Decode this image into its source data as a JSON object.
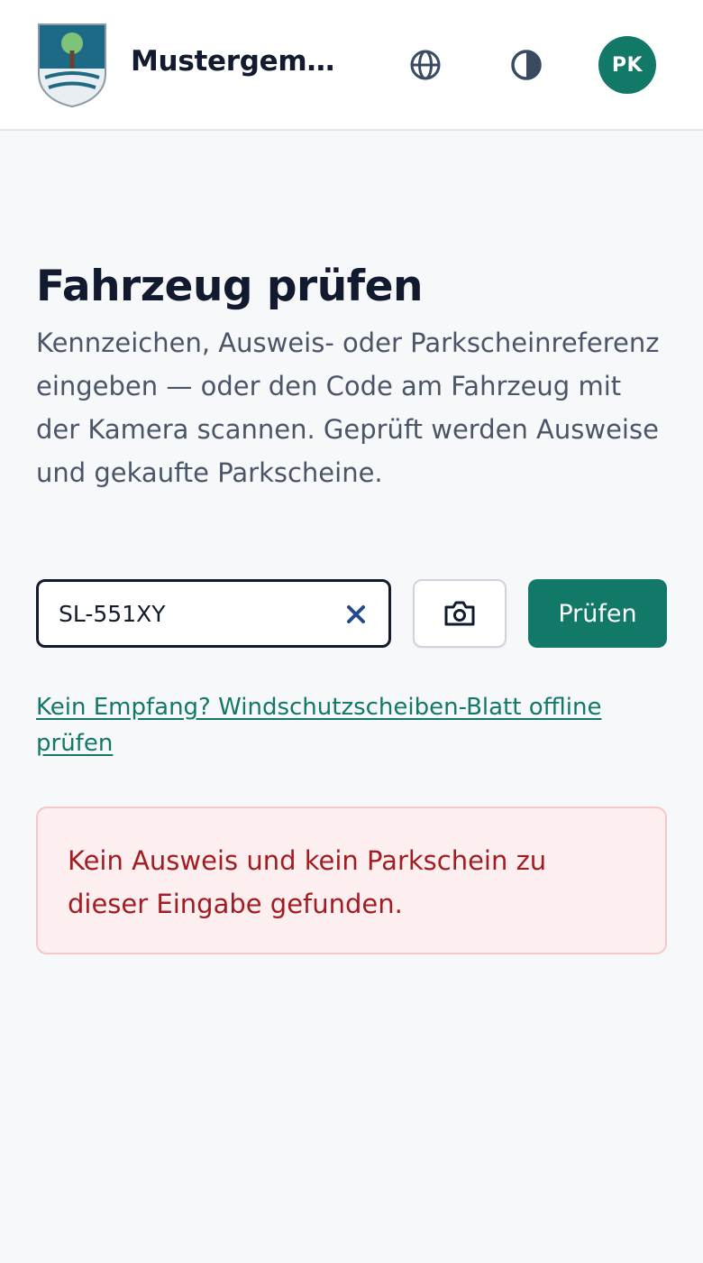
{
  "header": {
    "app_title": "Mustergemei...",
    "icons": {
      "crest": "municipal-crest-icon",
      "language": "globe-icon",
      "theme": "contrast-icon"
    },
    "avatar_initials": "PK"
  },
  "main": {
    "title": "Fahrzeug prüfen",
    "intro": "Kennzeichen, Ausweis- oder Parkscheinreferenz eingeben — oder den Code am Fahrzeug mit der Kamera scannen. Geprüft werden Ausweise und gekaufte Parkscheine.",
    "search": {
      "value": "SL-551XY",
      "clear_icon": "close-icon",
      "camera_icon": "camera-icon"
    },
    "check_label": "Prüfen",
    "offline_link": "Kein Empfang? Windschutzscheiben-Blatt offline prüfen",
    "error_message": "Kein Ausweis und kein Parkschein zu dieser Eingabe gefunden."
  },
  "colors": {
    "brand": "#127868",
    "error_text": "#a11d22",
    "error_bg": "#fdeff0",
    "error_border": "#f6c6c9",
    "background": "#f7f8fa"
  }
}
